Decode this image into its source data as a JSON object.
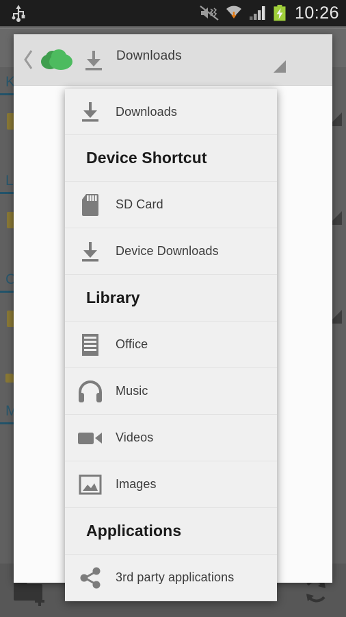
{
  "status_bar": {
    "icons": [
      "usb-icon",
      "vibrate-off-icon",
      "wifi-icon",
      "signal-icon",
      "battery-charging-icon"
    ],
    "clock": "10:26"
  },
  "dialog": {
    "header": {
      "back_icon": "back-chevron-icon",
      "logo_icon": "green-cloud-logo-icon",
      "path_icon": "download-icon",
      "title": "Downloads",
      "dropdown_indicator_icon": "triangle-indicator-icon"
    }
  },
  "menu": {
    "items": [
      {
        "type": "item",
        "label": "Downloads",
        "icon": "download-icon"
      },
      {
        "type": "header",
        "label": "Device Shortcut",
        "icon": ""
      },
      {
        "type": "item",
        "label": "SD Card",
        "icon": "sd-card-icon"
      },
      {
        "type": "item",
        "label": "Device Downloads",
        "icon": "download-icon"
      },
      {
        "type": "header",
        "label": "Library",
        "icon": ""
      },
      {
        "type": "item",
        "label": "Office",
        "icon": "document-icon"
      },
      {
        "type": "item",
        "label": "Music",
        "icon": "headphones-icon"
      },
      {
        "type": "item",
        "label": "Videos",
        "icon": "video-camera-icon"
      },
      {
        "type": "item",
        "label": "Images",
        "icon": "image-icon"
      },
      {
        "type": "header",
        "label": "Applications",
        "icon": ""
      },
      {
        "type": "item",
        "label": "3rd party applications",
        "icon": "share-icon"
      }
    ]
  },
  "background": {
    "section_letters": [
      "K",
      "L",
      "C",
      "M"
    ],
    "bottom_bar": {
      "new_folder_icon": "new-folder-icon",
      "refresh_icon": "refresh-icon"
    }
  },
  "colors": {
    "brand_green": "#4dbb5f",
    "brand_green_dark": "#3f9e4e",
    "status_bar": "#1d1d1d",
    "menu_bg": "#f0f0f0",
    "header_bg": "#dedede",
    "icon_gray": "#7c7c7c",
    "text_primary": "#3c3c3c",
    "bg_accent_blue": "#2a6f8f",
    "bg_folder_yellow": "#bba23c"
  }
}
